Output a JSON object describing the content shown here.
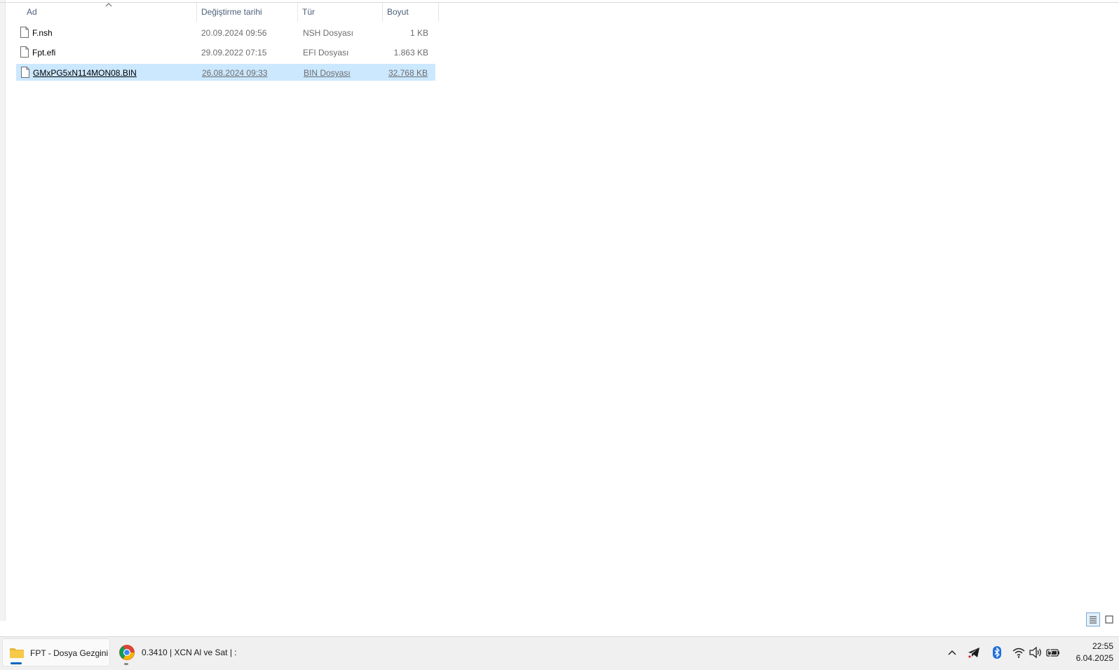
{
  "columns": {
    "name": "Ad",
    "modified": "Değiştirme tarihi",
    "type": "Tür",
    "size": "Boyut"
  },
  "files": [
    {
      "name": "F.nsh",
      "modified": "20.09.2024 09:56",
      "type": "NSH Dosyası",
      "size": "1 KB",
      "selected": false
    },
    {
      "name": "Fpt.efi",
      "modified": "29.09.2022 07:15",
      "type": "EFI Dosyası",
      "size": "1.863 KB",
      "selected": false
    },
    {
      "name": "GMxPG5xN114MON08.BIN",
      "modified": "26.08.2024 09:33",
      "type": "BIN Dosyası",
      "size": "32.768 KB",
      "selected": true
    }
  ],
  "taskbar": {
    "explorer_label": "FPT - Dosya Gezgini",
    "chrome_label": "0.3410 | XCN Al ve Sat | :",
    "time": "22:55",
    "date": "6.04.2025"
  },
  "icons": {
    "file": "file-icon",
    "folder": "folder-icon",
    "chrome": "chrome-icon",
    "tray": [
      "chevron-up-icon",
      "telegram-icon",
      "bluetooth-icon",
      "wifi-icon",
      "volume-icon",
      "battery-icon"
    ]
  },
  "colors": {
    "selection": "#cce8ff",
    "header_text": "#4c607a",
    "taskbar_bg": "#f0f0f0",
    "active_indicator": "#0067c0"
  }
}
